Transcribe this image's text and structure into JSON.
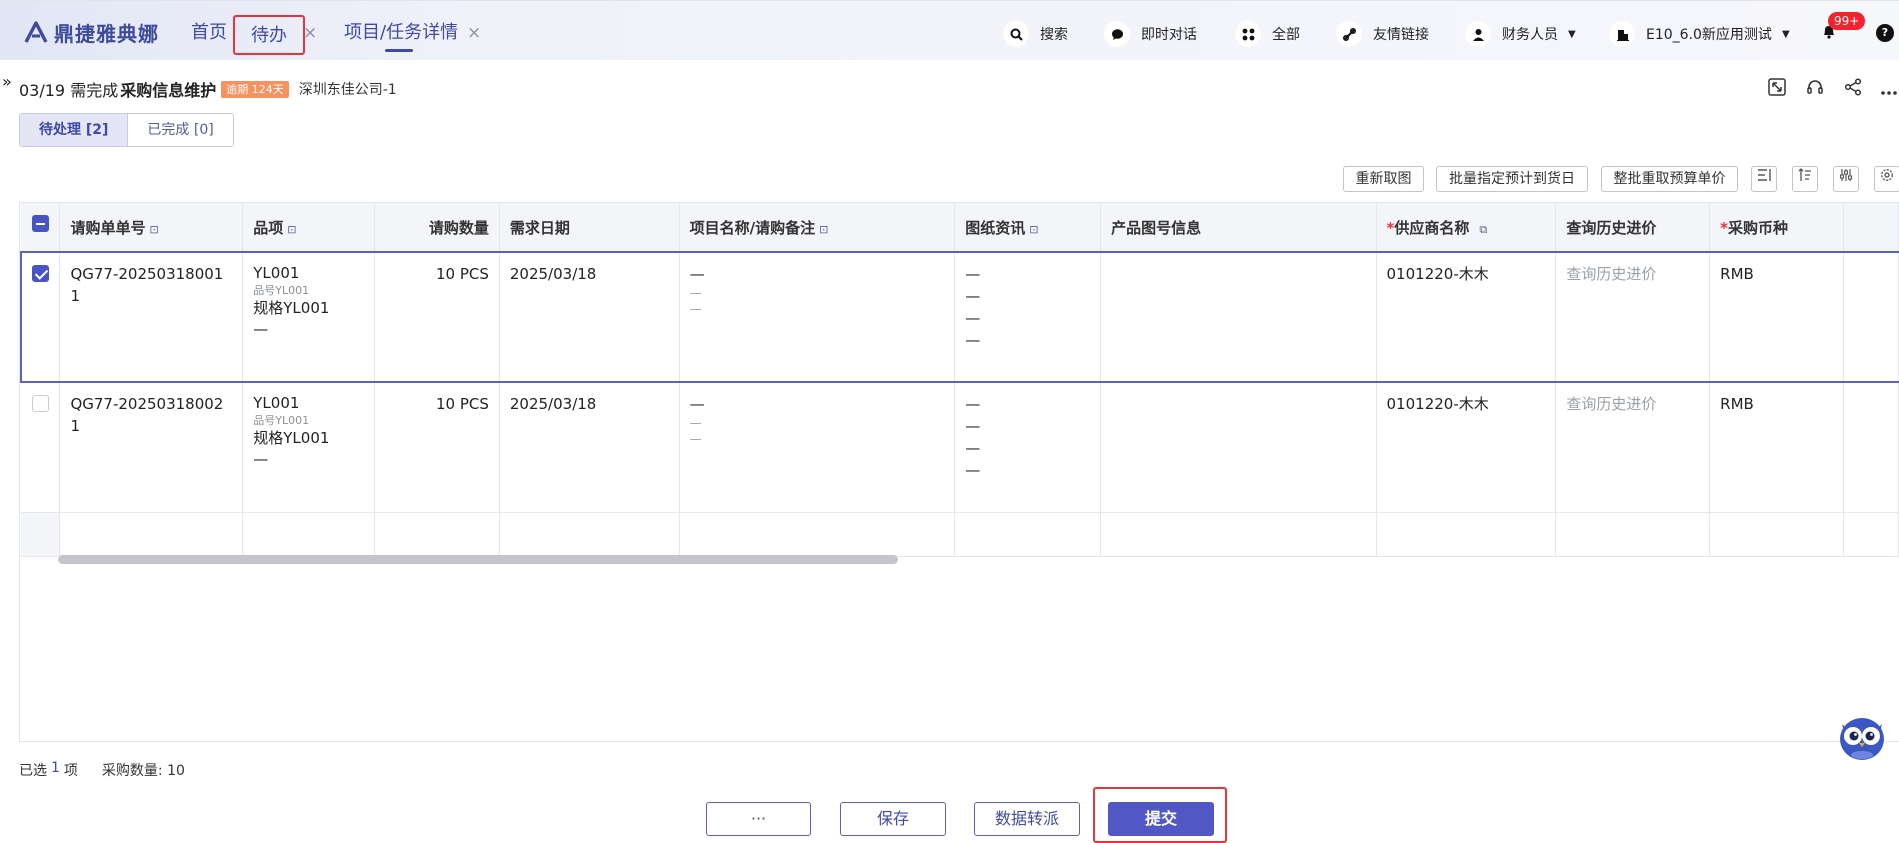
{
  "app": {
    "name": "鼎捷雅典娜"
  },
  "tabs": [
    {
      "label": "首页"
    },
    {
      "label": "待办"
    },
    {
      "label": "项目/任务详情"
    }
  ],
  "tools": {
    "search": "搜索",
    "chat": "即时对话",
    "all": "全部",
    "links": "友情链接",
    "user": "财务人员",
    "env": "E10_6.0新应用测试",
    "badge": "99+"
  },
  "task": {
    "due": "03/19 需完成",
    "title": "采购信息维护",
    "overdue": "逾期 124天",
    "company": "深圳东佳公司-1"
  },
  "segments": {
    "pending": "待处理 [2]",
    "done": "已完成 [0]"
  },
  "actions": {
    "reload_drawing": "重新取图",
    "batch_delivery": "批量指定预计到货日",
    "batch_price": "整批重取预算单价"
  },
  "table": {
    "headers": {
      "order_no": "请购单单号",
      "item": "品项",
      "qty": "请购数量",
      "date": "需求日期",
      "project": "项目名称/请购备注",
      "drawing": "图纸资讯",
      "product": "产品图号信息",
      "supplier": "供应商名称",
      "history": "查询历史进价",
      "currency": "采购币种"
    },
    "rows": [
      {
        "order_no": "QG77-20250318001",
        "seq": "1",
        "item": "YL001",
        "item_sub": "品号YL001",
        "spec": "规格YL001",
        "dash": "—",
        "qty": "10 PCS",
        "date": "2025/03/18",
        "proj1": "—",
        "proj2": "—",
        "proj3": "—",
        "draw1": "—",
        "draw2": "—",
        "draw3": "—",
        "draw4": "—",
        "supplier": "0101220-木木",
        "history": "查询历史进价",
        "currency": "RMB"
      },
      {
        "order_no": "QG77-20250318002",
        "seq": "1",
        "item": "YL001",
        "item_sub": "品号YL001",
        "spec": "规格YL001",
        "dash": "—",
        "qty": "10 PCS",
        "date": "2025/03/18",
        "proj1": "—",
        "proj2": "—",
        "proj3": "—",
        "draw1": "—",
        "draw2": "—",
        "draw3": "—",
        "draw4": "—",
        "supplier": "0101220-木木",
        "history": "查询历史进价",
        "currency": "RMB"
      }
    ]
  },
  "summary": {
    "selected_prefix": "已选",
    "selected_count": "1",
    "selected_suffix": "项",
    "qty": "采购数量: 10"
  },
  "footer": {
    "more": "···",
    "save": "保存",
    "transfer": "数据转派",
    "submit": "提交"
  }
}
